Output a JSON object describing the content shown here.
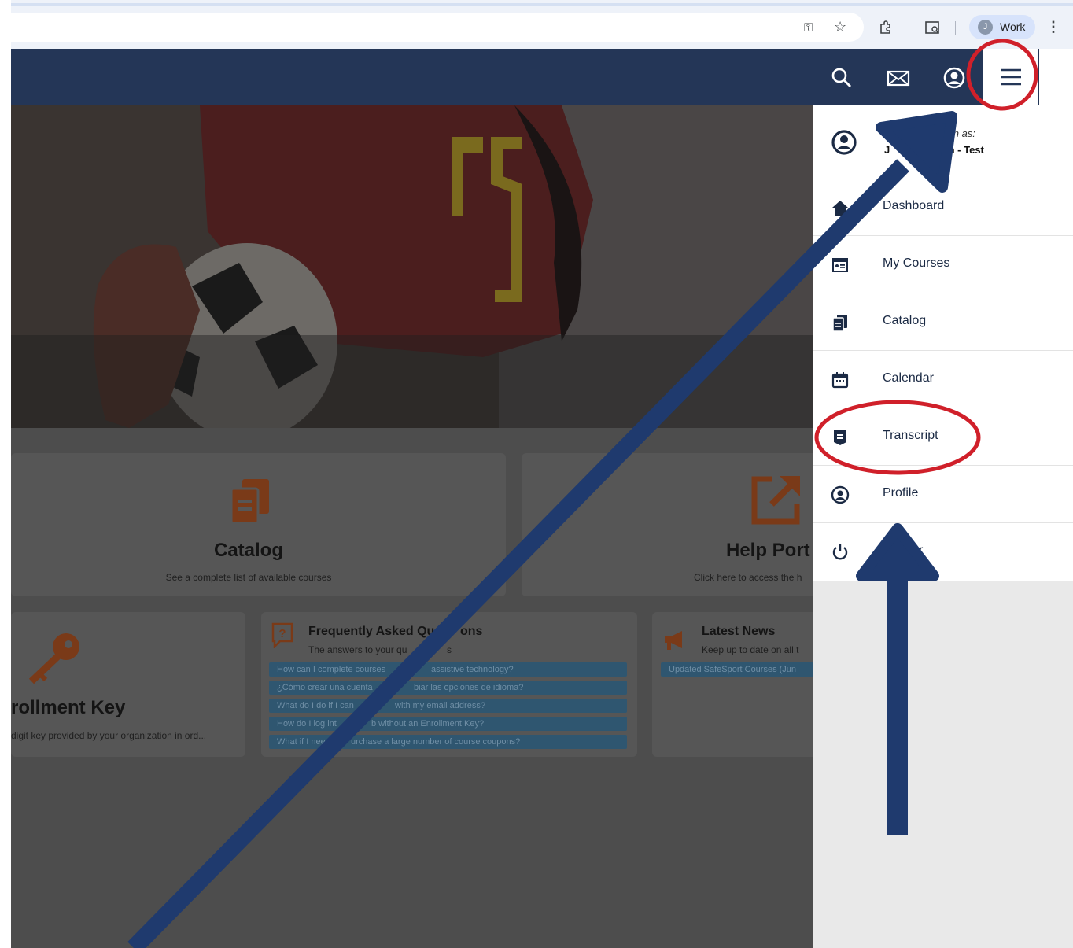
{
  "browser": {
    "profile_initial": "J",
    "profile_label": "Work",
    "icons": [
      "key-icon",
      "star-icon",
      "extensions-icon",
      "tab-search-icon",
      "kebab-menu-icon"
    ]
  },
  "header": {
    "icons": [
      "search-icon",
      "mail-icon",
      "account-circle-icon",
      "hamburger-menu-icon"
    ],
    "bg_color": "#243657"
  },
  "drawer": {
    "signed_in_line1": "d in as:",
    "signed_in_line2_left": "J",
    "signed_in_line2_right": "m - Test",
    "items": [
      {
        "label": "Dashboard",
        "icon": "home-icon"
      },
      {
        "label": "My Courses",
        "icon": "course-card-icon"
      },
      {
        "label": "Catalog",
        "icon": "catalog-icon"
      },
      {
        "label": "Calendar",
        "icon": "calendar-icon"
      },
      {
        "label": "Transcript",
        "icon": "transcript-icon"
      },
      {
        "label": "Profile",
        "icon": "profile-icon"
      },
      {
        "label": "r",
        "icon": "power-icon"
      }
    ]
  },
  "page": {
    "catalog_card": {
      "title": "Catalog",
      "subtitle": "See a complete list of available courses"
    },
    "help_card": {
      "title": "Help Port",
      "subtitle": "Click here to access the h"
    },
    "enrollment_card": {
      "title": "rollment Key",
      "subtitle": "digit key provided by your organization in ord..."
    },
    "faq_card": {
      "title_left": "Frequently Asked Qu",
      "title_right": "ons",
      "subtitle_left": "The answers to your qu",
      "subtitle_right": "s",
      "links": [
        {
          "left": "How can I complete courses",
          "right": "assistive technology?"
        },
        {
          "left": "¿Cómo crear una cuenta",
          "right": "biar las opciones de idioma?"
        },
        {
          "left": "What do I do if I can",
          "right": "with my email address?"
        },
        {
          "left": "How do I log int",
          "right": "b without an Enrollment Key?"
        },
        {
          "left": "What if I nee",
          "right": "urchase a large number of course coupons?"
        }
      ]
    },
    "news_card": {
      "title": "Latest News",
      "subtitle": "Keep up to date on all t",
      "link": "Updated SafeSport Courses (Jun"
    }
  },
  "annotations": {
    "highlight_color": "#d0202a",
    "arrow_color": "#1f3a6e"
  }
}
